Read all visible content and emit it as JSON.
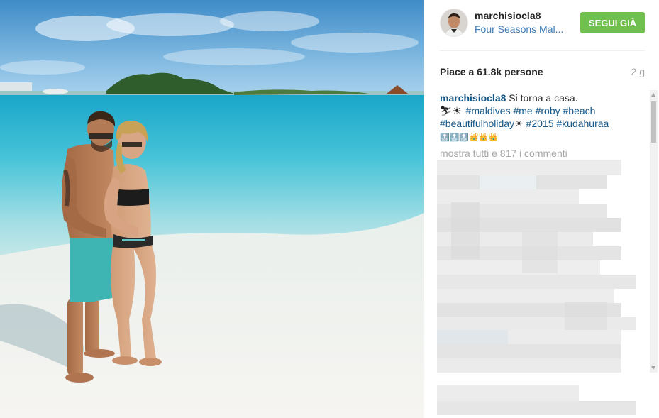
{
  "post": {
    "username": "marchisiocla8",
    "location": "Four Seasons Mal...",
    "follow_label": "SEGUI GIÀ",
    "likes": "Piace a 61.8k persone",
    "time": "2 g",
    "caption_user": "marchisiocla8",
    "caption_text": " Si torna a casa.",
    "caption_emoji_line": "⛷☀ ",
    "hashtags_line1": [
      "#maldives",
      "#me",
      "#roby",
      "#beach"
    ],
    "hashtag_holiday": "#beautifulholiday",
    "emoji_sun": "☀",
    "hashtags_line2": [
      "#2015",
      "#kudahuraa"
    ],
    "emoji_line3": "🔝🔝🔝👑👑👑",
    "show_all_comments": "mostra tutti e 817 i commenti"
  },
  "colors": {
    "follow_bg": "#70c050",
    "link": "#125688",
    "location": "#3b7ab3",
    "muted": "#a5a7aa"
  },
  "icons": {
    "avatar": "profile-photo",
    "photo": "beach-couple-photo"
  }
}
